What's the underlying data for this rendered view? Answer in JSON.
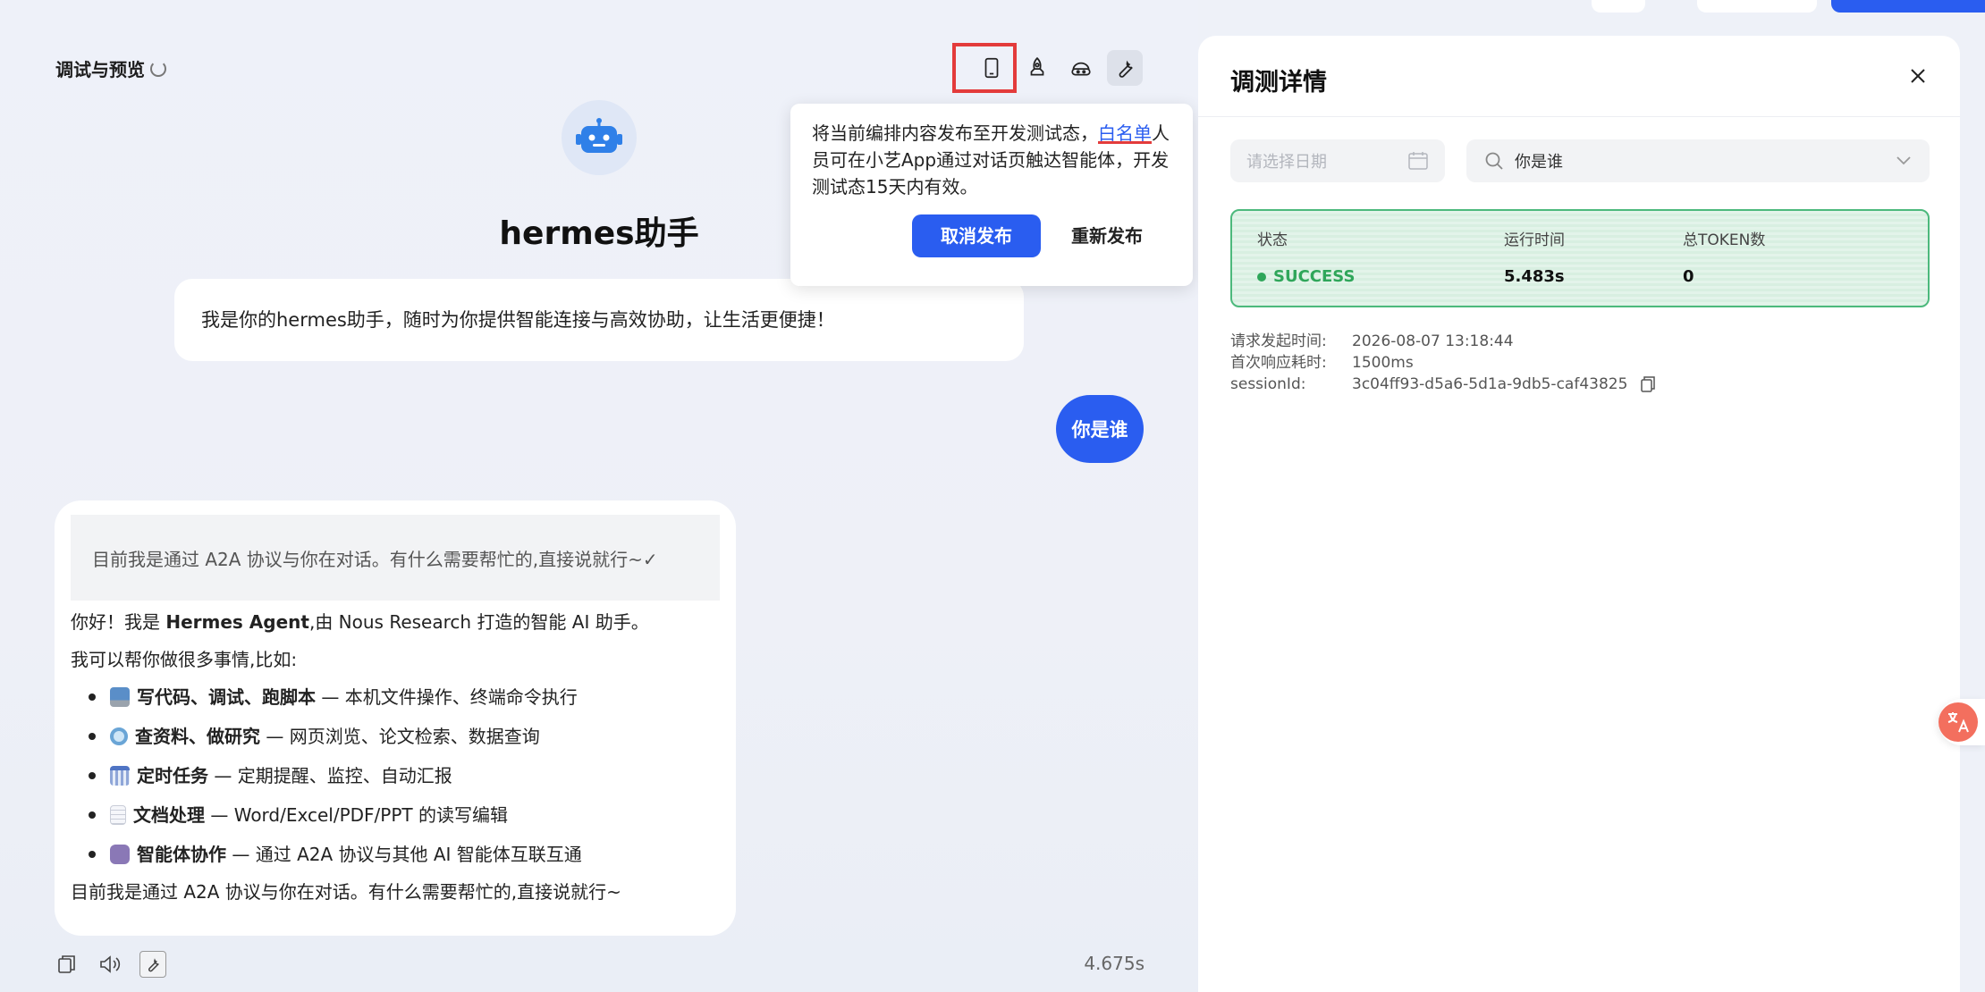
{
  "header": {
    "title": "调试与预览"
  },
  "bot": {
    "name": "hermes助手",
    "welcome": "我是你的hermes助手，随时为你提供智能连接与高效协助，让生活更便捷！"
  },
  "chat": {
    "user_message": "你是谁",
    "answer": {
      "quote": "目前我是通过 A2A 协议与你在对话。有什么需要帮忙的,直接说就行~✓",
      "intro_prefix": "你好！我是 ",
      "intro_bold": "Hermes Agent",
      "intro_suffix": ",由 Nous Research 打造的智能 AI 助手。",
      "lead": "我可以帮你做很多事情,比如:",
      "items": [
        {
          "icon": "laptop-icon",
          "title": "写代码、调试、跑脚本",
          "desc": " — 本机文件操作、终端命令执行"
        },
        {
          "icon": "magnifier-icon",
          "title": "查资料、做研究",
          "desc": " — 网页浏览、论文检索、数据查询"
        },
        {
          "icon": "calendar-icon",
          "title": "定时任务",
          "desc": " — 定期提醒、监控、自动汇报"
        },
        {
          "icon": "document-icon",
          "title": "文档处理",
          "desc": " — Word/Excel/PDF/PPT 的读写编辑"
        },
        {
          "icon": "robot-icon",
          "title": "智能体协作",
          "desc": " — 通过 A2A 协议与其他 AI 智能体互联互通"
        }
      ],
      "closing": "目前我是通过 A2A 协议与你在对话。有什么需要帮忙的,直接说就行~"
    },
    "elapsed": "4.675s"
  },
  "popover": {
    "text_before": "将当前编排内容发布至开发测试态，",
    "link": "白名单",
    "text_after": "人员可在小艺App通过对话页触达智能体，开发测试态15天内有效。",
    "primary_label": "取消发布",
    "secondary_label": "重新发布"
  },
  "detail_panel": {
    "title": "调测详情",
    "date_placeholder": "请选择日期",
    "search_value": "你是谁",
    "status_card": {
      "status_header": "状态",
      "runtime_header": "运行时间",
      "token_header": "总TOKEN数",
      "status_value": "SUCCESS",
      "runtime_value": "5.483s",
      "token_value": "0"
    },
    "meta": [
      {
        "label": "请求发起时间:",
        "value": "2026-08-07 13:18:44"
      },
      {
        "label": "首次响应耗时:",
        "value": "1500ms"
      },
      {
        "label": "sessionId:",
        "value": "3c04ff93-d5a6-5d1a-9db5-caf43825"
      }
    ]
  },
  "colors": {
    "accent": "#2a5df0",
    "success": "#2fa65a",
    "highlight": "#e33b3b"
  }
}
